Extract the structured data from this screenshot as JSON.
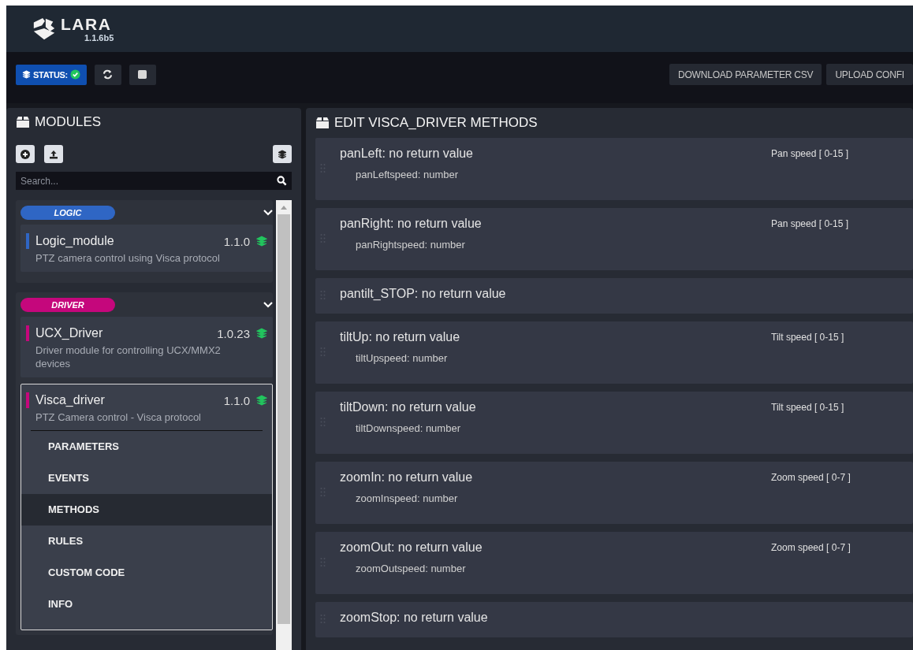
{
  "header": {
    "logo": "LARA",
    "version": "1.1.6b5"
  },
  "toolbar": {
    "status_label": "STATUS:",
    "status_ok": true,
    "buttons": [
      "DOWNLOAD PARAMETER CSV",
      "UPLOAD CONFI"
    ]
  },
  "modules_panel": {
    "title": "MODULES",
    "search": {
      "placeholder": "Search..."
    },
    "groups": [
      {
        "label": "LOGIC",
        "color": "#2f66c4",
        "expanded": true,
        "modules": [
          {
            "name": "Logic_module",
            "version": "1.1.0",
            "description": "PTZ camera control using Visca protocol",
            "selected": false
          }
        ]
      },
      {
        "label": "DRIVER",
        "color": "#c5077c",
        "expanded": true,
        "modules": [
          {
            "name": "UCX_Driver",
            "version": "1.0.23",
            "description": "Driver module for controlling UCX/MMX2 devices",
            "selected": false
          },
          {
            "name": "Visca_driver",
            "version": "1.1.0",
            "description": "PTZ Camera control - Visca protocol",
            "selected": true,
            "menu": [
              {
                "label": "PARAMETERS",
                "selected": false
              },
              {
                "label": "EVENTS",
                "selected": false
              },
              {
                "label": "METHODS",
                "selected": true
              },
              {
                "label": "RULES",
                "selected": false
              },
              {
                "label": "CUSTOM CODE",
                "selected": false
              },
              {
                "label": "INFO",
                "selected": false
              }
            ]
          }
        ]
      }
    ]
  },
  "methods_panel": {
    "title": "EDIT VISCA_DRIVER METHODS",
    "methods": [
      {
        "signature": "panLeft: no return value",
        "hint": "Pan speed [ 0-15 ]",
        "params": [
          "panLeftspeed: number"
        ]
      },
      {
        "signature": "panRight: no return value",
        "hint": "Pan speed [ 0-15 ]",
        "params": [
          "panRightspeed: number"
        ]
      },
      {
        "signature": "pantilt_STOP: no return value"
      },
      {
        "signature": "tiltUp: no return value",
        "hint": "Tilt speed [ 0-15 ]",
        "params": [
          "tiltUpspeed: number"
        ]
      },
      {
        "signature": "tiltDown: no return value",
        "hint": "Tilt speed [ 0-15 ]",
        "params": [
          "tiltDownspeed: number"
        ]
      },
      {
        "signature": "zoomIn: no return value",
        "hint": "Zoom speed [ 0-7 ]",
        "params": [
          "zoomInspeed: number"
        ]
      },
      {
        "signature": "zoomOut: no return value",
        "hint": "Zoom speed [ 0-7 ]",
        "params": [
          "zoomOutspeed: number"
        ]
      },
      {
        "signature": "zoomStop: no return value"
      }
    ]
  }
}
